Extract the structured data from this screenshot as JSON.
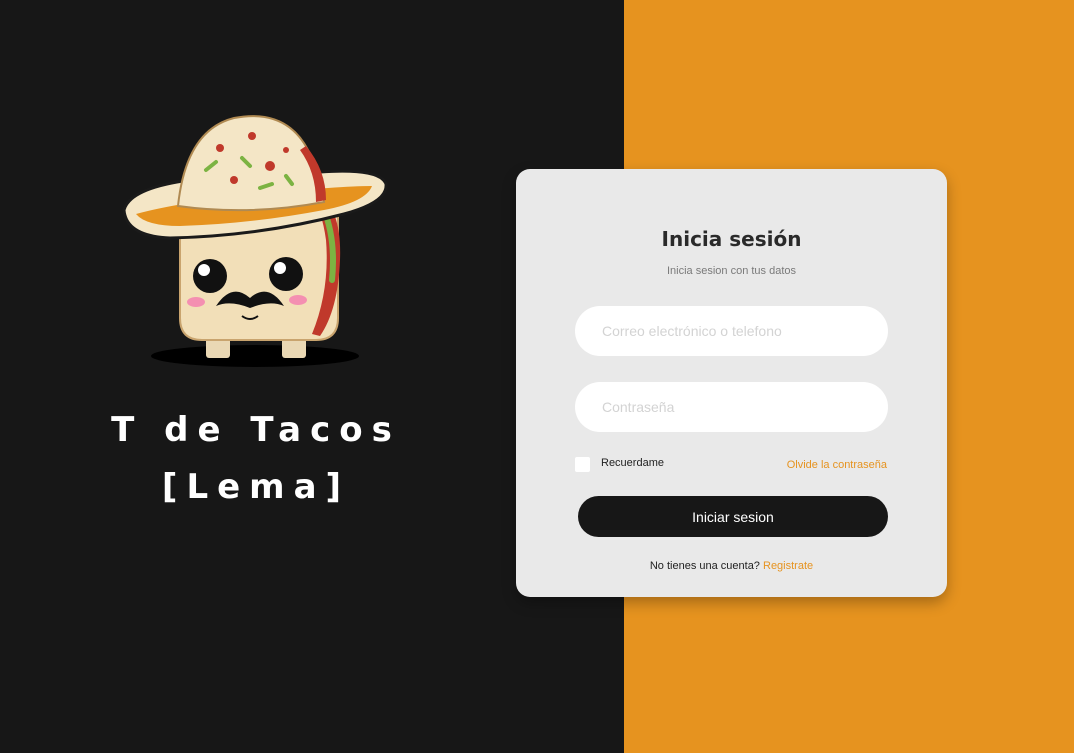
{
  "brand": {
    "name": "T de Tacos",
    "slogan": "[Lema]"
  },
  "login": {
    "title": "Inicia sesión",
    "subtitle": "Inicia sesion con tus datos",
    "email_placeholder": "Correo electrónico o telefono",
    "password_placeholder": "Contraseña",
    "remember_label": "Recuerdame",
    "forgot_label": "Olvide la contraseña",
    "submit_label": "Iniciar sesion",
    "signup_prompt": "No tienes una cuenta?",
    "signup_link": "Registrate"
  },
  "colors": {
    "dark": "#171717",
    "accent": "#e6931f",
    "card": "#e9e9e9"
  },
  "icons": {
    "mascot": "taco-sombrero-mascot-icon"
  }
}
